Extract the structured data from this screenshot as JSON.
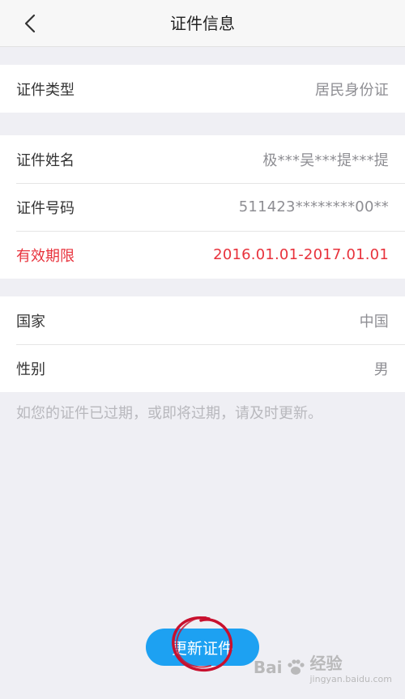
{
  "nav": {
    "title": "证件信息"
  },
  "section1": [
    {
      "label": "证件类型",
      "value": "居民身份证"
    }
  ],
  "section2": [
    {
      "label": "证件姓名",
      "value": "极***吴***提***提"
    },
    {
      "label": "证件号码",
      "value": "511423********00**"
    },
    {
      "label": "有效期限",
      "value": "2016.01.01-2017.01.01"
    }
  ],
  "section3": [
    {
      "label": "国家",
      "value": "中国"
    },
    {
      "label": "性别",
      "value": "男"
    }
  ],
  "notice": "如您的证件已过期，或即将过期，请及时更新。",
  "button": {
    "label": "更新证件"
  },
  "watermark": {
    "text": "Bai",
    "text2": "经验",
    "sub": "jingyan.baidu.com"
  },
  "colors": {
    "accent": "#1da1f2",
    "alert": "#e8323c",
    "background": "#efeff4"
  }
}
